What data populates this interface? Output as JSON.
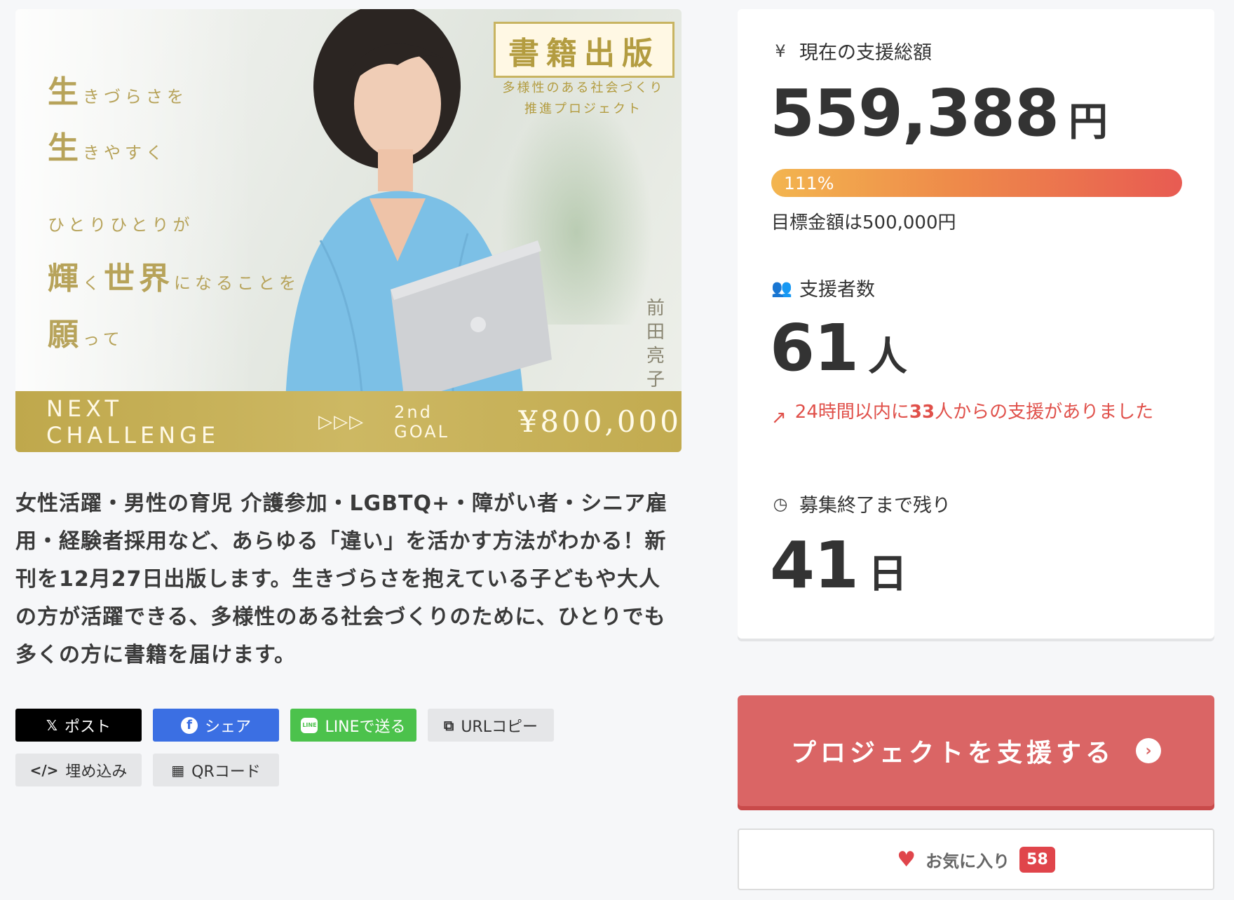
{
  "hero": {
    "line1_big": "生",
    "line1_small": "きづらさを",
    "line2_big": "生",
    "line2_small": "きやすく",
    "line3": "ひとりひとりが",
    "line4_big1": "輝",
    "line4_small1": "く",
    "line4_big2": "世界",
    "line4_small2": "になることを",
    "line5_big": "願",
    "line5_small": "って",
    "badge_title": "書籍出版",
    "badge_sub1": "多様性のある社会づくり",
    "badge_sub2": "推進プロジェクト",
    "author": "前田亮子",
    "band_next": "NEXT CHALLENGE",
    "band_arrows": "▷▷▷",
    "band_goal": "2nd GOAL",
    "band_amount": "¥800,000"
  },
  "description": "女性活躍・男性の育児 介護参加・LGBTQ+・障がい者・シニア雇用・経験者採用など、あらゆる「違い」を活かす方法がわかる！新刊を12月27日出版します。生きづらさを抱えている子どもや大人の方が活躍できる、多様性のある社会づくりのために、ひとりでも多くの方に書籍を届けます。",
  "share": {
    "post": "ポスト",
    "facebook": "シェア",
    "line": "LINEで送る",
    "line_icon": "LINE",
    "url": "URLコピー",
    "embed": "埋め込み",
    "qr": "QRコード"
  },
  "stats": {
    "total_label": "現在の支援総額",
    "total_value": "559,388",
    "total_unit": "円",
    "progress_percent": 111,
    "progress_label": "111%",
    "goal_text": "目標金額は500,000円",
    "supporters_label": "支援者数",
    "supporters_value": "61",
    "supporters_unit": "人",
    "trend_prefix": "24時間以内に",
    "trend_count": "33",
    "trend_suffix": "人からの支援がありました",
    "remaining_label": "募集終了まで残り",
    "remaining_value": "41",
    "remaining_unit": "日"
  },
  "cta": {
    "label": "プロジェクトを支援する"
  },
  "favorite": {
    "label": "お気に入り",
    "count": "58"
  },
  "colors": {
    "accent": "#da6565",
    "gold": "#c2ab50",
    "trend": "#e0504a"
  }
}
